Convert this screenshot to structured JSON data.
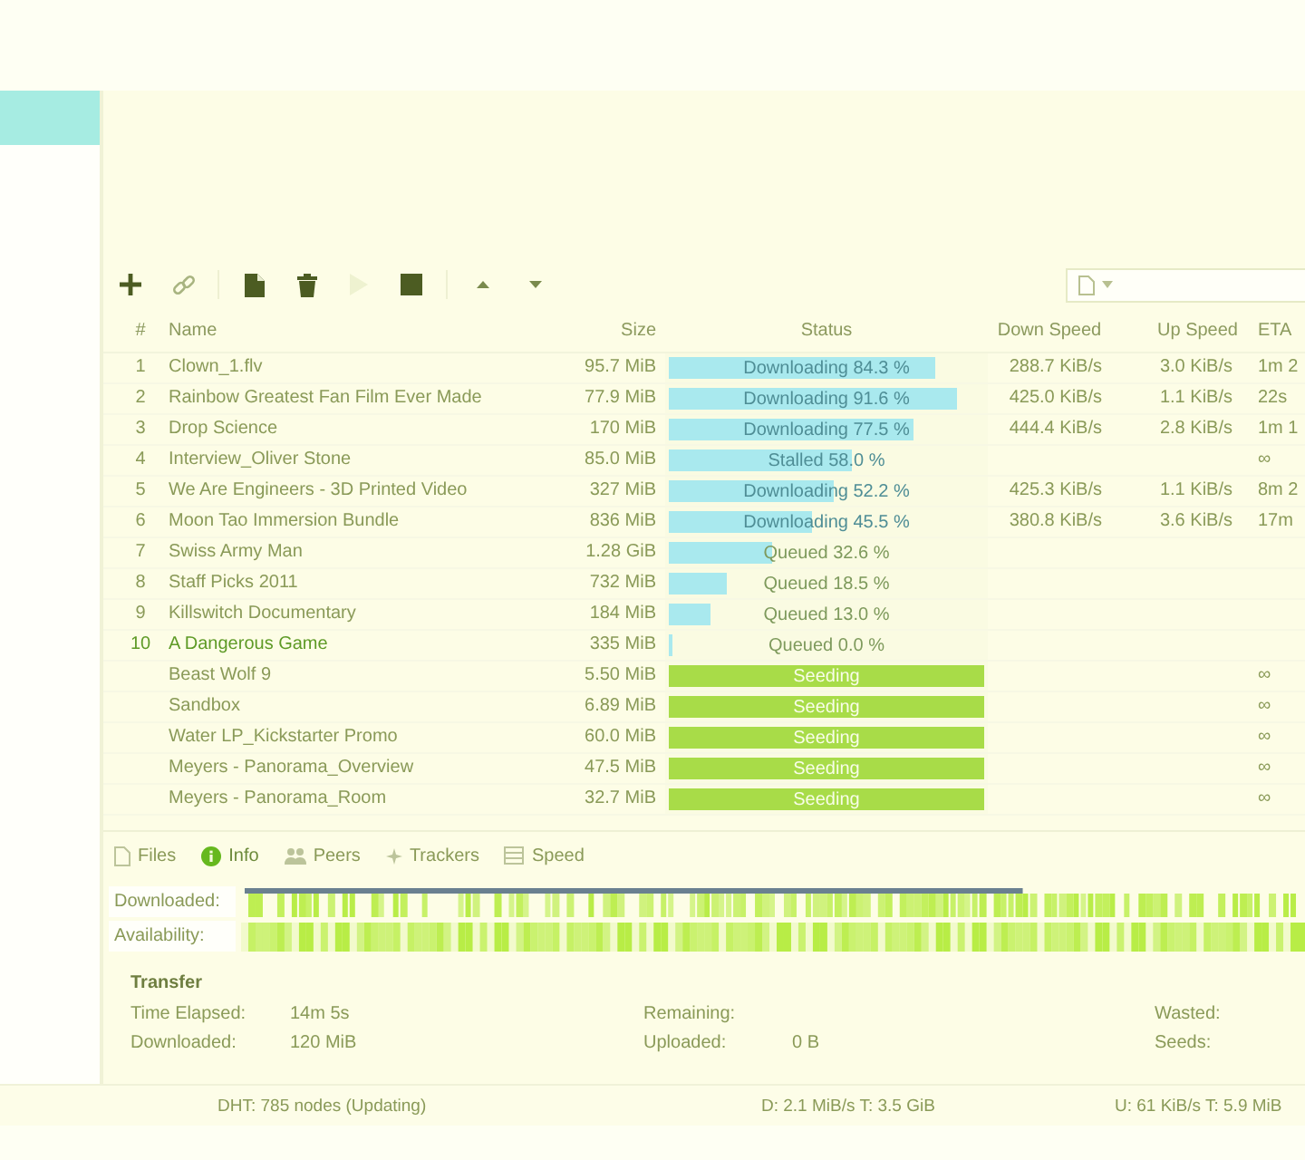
{
  "sidebar": {
    "items": [
      {
        "selected": true
      }
    ]
  },
  "toolbar": {
    "buttons": [
      {
        "disabled": false
      },
      {
        "disabled": false
      },
      {
        "disabled": false
      },
      {
        "disabled": false
      },
      {
        "disabled": true
      },
      {
        "disabled": false
      },
      {
        "disabled": false
      },
      {
        "disabled": false
      }
    ]
  },
  "table": {
    "columns": [
      "#",
      "Name",
      "Size",
      "Status",
      "Down Speed",
      "Up Speed",
      "ETA"
    ],
    "rows": [
      {
        "number": "1",
        "name": "Clown_1.flv",
        "size": "95.7 MiB",
        "kind": "downloading",
        "level": 0.843,
        "status": "Downloading 84.3 %",
        "down_speed": "288.7 KiB/s",
        "up_speed": "3.0 KiB/s",
        "eta": "1m 2",
        "selected": false
      },
      {
        "number": "2",
        "name": "Rainbow Greatest Fan Film Ever Made",
        "size": "77.9 MiB",
        "kind": "downloading",
        "level": 0.916,
        "status": "Downloading 91.6 %",
        "down_speed": "425.0 KiB/s",
        "up_speed": "1.1 KiB/s",
        "eta": "22s",
        "selected": false
      },
      {
        "number": "3",
        "name": "Drop Science",
        "size": "170 MiB",
        "kind": "downloading",
        "level": 0.775,
        "status": "Downloading 77.5 %",
        "down_speed": "444.4 KiB/s",
        "up_speed": "2.8 KiB/s",
        "eta": "1m 1",
        "selected": false
      },
      {
        "number": "4",
        "name": "Interview_Oliver Stone",
        "size": "85.0 MiB",
        "kind": "downloading",
        "level": 0.58,
        "status": "Stalled 58.0 %",
        "eta": "∞",
        "selected": false
      },
      {
        "number": "5",
        "name": "We Are Engineers - 3D Printed Video",
        "size": "327 MiB",
        "kind": "downloading",
        "level": 0.522,
        "status": "Downloading 52.2 %",
        "down_speed": "425.3 KiB/s",
        "up_speed": "1.1 KiB/s",
        "eta": "8m 2",
        "selected": false
      },
      {
        "number": "6",
        "name": "Moon Tao Immersion Bundle",
        "size": "836 MiB",
        "kind": "downloading",
        "level": 0.455,
        "status": "Downloading 45.5 %",
        "down_speed": "380.8 KiB/s",
        "up_speed": "3.6 KiB/s",
        "eta": "17m",
        "selected": false
      },
      {
        "number": "7",
        "name": "Swiss Army Man",
        "size": "1.28 GiB",
        "kind": "queued",
        "level": 0.326,
        "status": "Queued 32.6 %",
        "selected": false
      },
      {
        "number": "8",
        "name": "Staff Picks 2011",
        "size": "732 MiB",
        "kind": "queued",
        "level": 0.185,
        "status": "Queued 18.5 %",
        "selected": false
      },
      {
        "number": "9",
        "name": "Killswitch Documentary",
        "size": "184 MiB",
        "kind": "queued",
        "level": 0.13,
        "status": "Queued 13.0 %",
        "selected": false
      },
      {
        "number": "10",
        "name": "A Dangerous Game",
        "size": "335 MiB",
        "kind": "queued",
        "level": 0,
        "status": "Queued 0.0 %",
        "selected": true
      },
      {
        "name": "Beast Wolf 9",
        "size": "5.50 MiB",
        "kind": "seeding",
        "level": 1,
        "status": "Seeding",
        "eta": "∞",
        "selected": false
      },
      {
        "name": "Sandbox",
        "size": "6.89 MiB",
        "kind": "seeding",
        "level": 1,
        "status": "Seeding",
        "eta": "∞",
        "selected": false
      },
      {
        "name": "Water LP_Kickstarter Promo",
        "size": "60.0 MiB",
        "kind": "seeding",
        "level": 1,
        "status": "Seeding",
        "eta": "∞",
        "selected": false
      },
      {
        "name": "Meyers - Panorama_Overview",
        "size": "47.5 MiB",
        "kind": "seeding",
        "level": 1,
        "status": "Seeding",
        "eta": "∞",
        "selected": false
      },
      {
        "name": "Meyers - Panorama_Room",
        "size": "32.7 MiB",
        "kind": "seeding",
        "level": 1,
        "status": "Seeding",
        "eta": "∞",
        "selected": false
      }
    ]
  },
  "detail_tabs": [
    {
      "label": "Files",
      "selected": false
    },
    {
      "label": "Info",
      "selected": true
    },
    {
      "label": "Peers",
      "selected": false
    },
    {
      "label": "Trackers",
      "selected": false
    },
    {
      "label": "Speed",
      "selected": false
    }
  ],
  "pieces": {
    "downloaded_label": "Downloaded:",
    "availability_label": "Availability:"
  },
  "transfer": {
    "title": "Transfer",
    "fields": [
      {
        "label": "Time Elapsed:",
        "value": "14m 5s"
      },
      {
        "label": "Remaining:"
      },
      {
        "label": "Wasted:"
      },
      {
        "label": "Downloaded:",
        "value": "120 MiB"
      },
      {
        "label": "Uploaded:",
        "value": "0 B"
      },
      {
        "label": "Seeds:"
      }
    ]
  },
  "status_bar": {
    "dht": "DHT: 785 nodes (Updating)",
    "download": "D: 2.1 MiB/s T: 3.5 GiB",
    "upload": "U: 61 KiB/s T: 5.9 MiB"
  }
}
